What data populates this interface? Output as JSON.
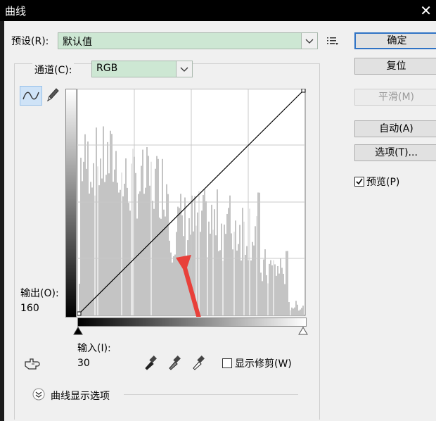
{
  "window": {
    "title": "曲线"
  },
  "preset": {
    "label": "预设(R):",
    "value": "默认值"
  },
  "channel": {
    "label": "通道(C):",
    "value": "RGB"
  },
  "output": {
    "label": "输出(O):",
    "value": "160"
  },
  "input": {
    "label": "输入(I):",
    "value": "30"
  },
  "clipping": {
    "label": "显示修剪(W)",
    "checked": false
  },
  "curve_options": {
    "label": "曲线显示选项"
  },
  "buttons": {
    "ok": "确定",
    "reset": "复位",
    "smooth": "平滑(M)",
    "auto": "自动(A)",
    "options": "选项(T)..."
  },
  "preview": {
    "label": "预览(P)",
    "checked": true
  },
  "colors": {
    "combo_bg": "#cde7d3",
    "default_border": "#2f73c5",
    "annotation_arrow": "#e8403a"
  }
}
